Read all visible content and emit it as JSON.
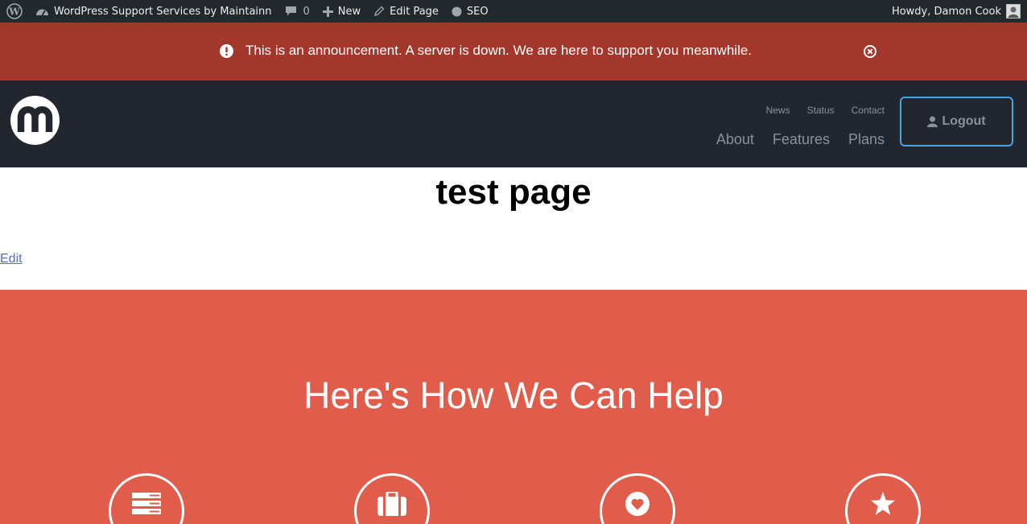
{
  "adminbar": {
    "site_name": "WordPress Support Services by Maintainn",
    "comments_count": "0",
    "new_label": "New",
    "edit_page_label": "Edit Page",
    "seo_label": "SEO",
    "howdy": "Howdy, Damon Cook"
  },
  "announcement": {
    "message": "This is an announcement. A server is down. We are here to support you meanwhile."
  },
  "header": {
    "top_links": [
      "News",
      "Status",
      "Contact"
    ],
    "main_links": [
      "About",
      "Features",
      "Plans"
    ],
    "logout_label": "Logout"
  },
  "page": {
    "title": "test page",
    "edit_label": "Edit"
  },
  "help": {
    "title": "Here's How We Can Help",
    "icons": [
      "server-icon",
      "briefcase-icon",
      "heart-icon",
      "star-icon"
    ]
  },
  "colors": {
    "adminbar": "#23282d",
    "announcement": "#a3372b",
    "header": "#22262e",
    "help_section": "#e05c4b",
    "logout_border": "#4aa3df",
    "link": "#4f6ed0"
  }
}
